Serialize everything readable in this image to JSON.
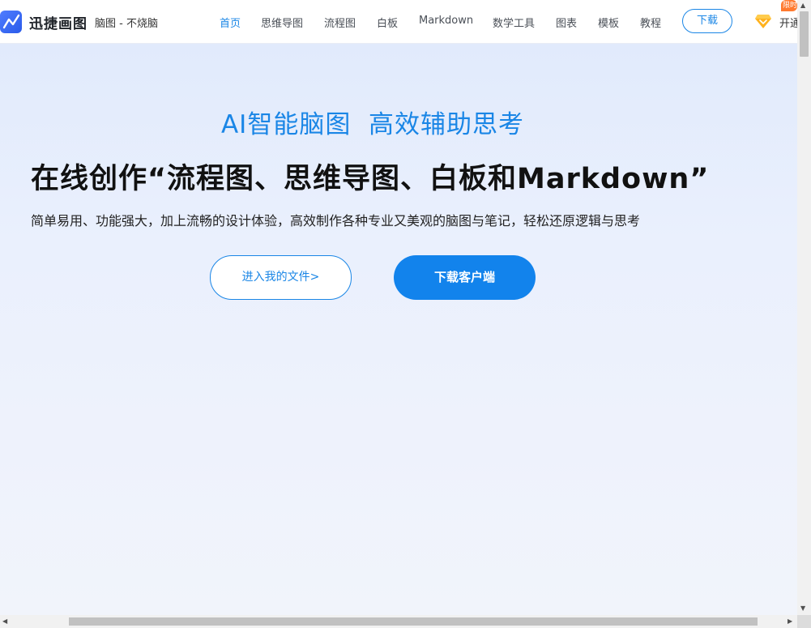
{
  "header": {
    "brand": "迅捷画图",
    "slogan": "脑图 - 不烧脑",
    "nav": [
      {
        "label": "首页",
        "active": true
      },
      {
        "label": "思维导图"
      },
      {
        "label": "流程图"
      },
      {
        "label": "白板"
      },
      {
        "label": "Markdown"
      },
      {
        "label": "数学工具"
      },
      {
        "label": "图表"
      },
      {
        "label": "模板"
      },
      {
        "label": "教程"
      }
    ],
    "download_label": "下载",
    "vip_label": "开通",
    "vip_badge": "限时"
  },
  "hero": {
    "subtitle": "AI智能脑图  高效辅助思考",
    "title": "在线创作“流程图、思维导图、白板和Markdown”",
    "description": "简单易用、功能强大，加上流畅的设计体验，高效制作各种专业又美观的脑图与笔记，轻松还原逻辑与思考",
    "btn_files": "进入我的文件>",
    "btn_client": "下载客户端"
  },
  "colors": {
    "accent": "#1a86e6",
    "primary_button": "#1283ec",
    "vip_badge": "#ff7a2f"
  },
  "icons": {
    "logo": "chart-line-icon",
    "vip": "diamond-icon"
  }
}
